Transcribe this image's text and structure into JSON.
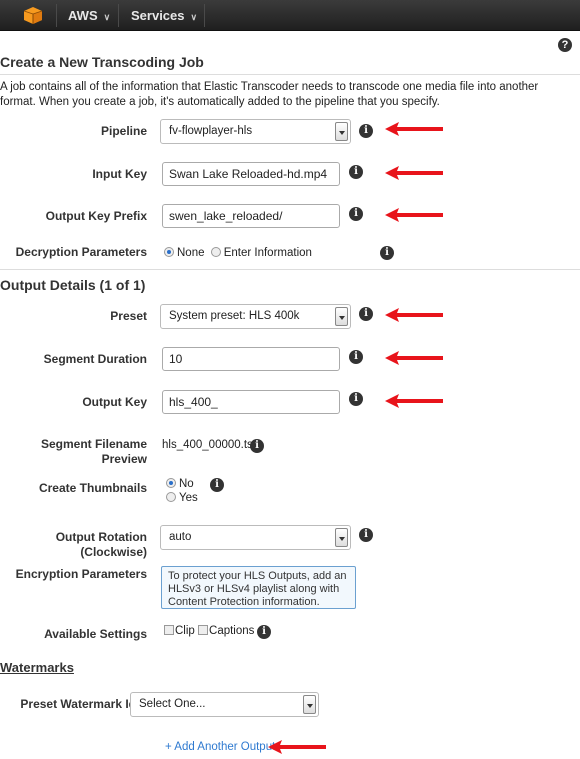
{
  "topbar": {
    "brand_label": "AWS",
    "services_label": "Services",
    "logo_color": "#f79a1f"
  },
  "page": {
    "title": "Create a New Transcoding Job",
    "description": "A job contains all of the information that Elastic Transcoder needs to transcode one media file into another format. When you create a job, it's automatically added to the pipeline that you specify.",
    "help_icon": "?"
  },
  "job": {
    "pipeline": {
      "label": "Pipeline",
      "value": "fv-flowplayer-hls"
    },
    "input_key": {
      "label": "Input Key",
      "value": "Swan Lake Reloaded-hd.mp4"
    },
    "output_key_prefix": {
      "label": "Output Key Prefix",
      "value": "swen_lake_reloaded/"
    },
    "decryption": {
      "label": "Decryption Parameters",
      "options": [
        "None",
        "Enter Information"
      ],
      "selected": "None"
    }
  },
  "output": {
    "title": "Output Details (1 of 1)",
    "preset": {
      "label": "Preset",
      "value": "System preset: HLS 400k"
    },
    "segment_duration": {
      "label": "Segment Duration",
      "value": "10"
    },
    "output_key": {
      "label": "Output Key",
      "value": "hls_400_"
    },
    "segment_preview": {
      "label_line1": "Segment Filename",
      "label_line2": "Preview",
      "value": "hls_400_00000.ts"
    },
    "thumbnails": {
      "label": "Create Thumbnails",
      "options": [
        "No",
        "Yes"
      ],
      "selected": "No"
    },
    "rotation": {
      "label_line1": "Output Rotation",
      "label_line2": "(Clockwise)",
      "value": "auto"
    },
    "encryption": {
      "label": "Encryption Parameters",
      "notice": "To protect your HLS Outputs, add an HLSv3 or HLSv4 playlist along with Content Protection information."
    },
    "available_settings": {
      "label": "Available Settings",
      "options": [
        "Clip",
        "Captions"
      ]
    }
  },
  "watermarks": {
    "title": "Watermarks",
    "preset_label": "Preset Watermark Id",
    "preset_value": "Select One..."
  },
  "add_output_label": "+ Add Another Output",
  "colors": {
    "arrow": "#e8141b",
    "link": "#2f7ad0",
    "notice_border": "#6ba0d0"
  }
}
